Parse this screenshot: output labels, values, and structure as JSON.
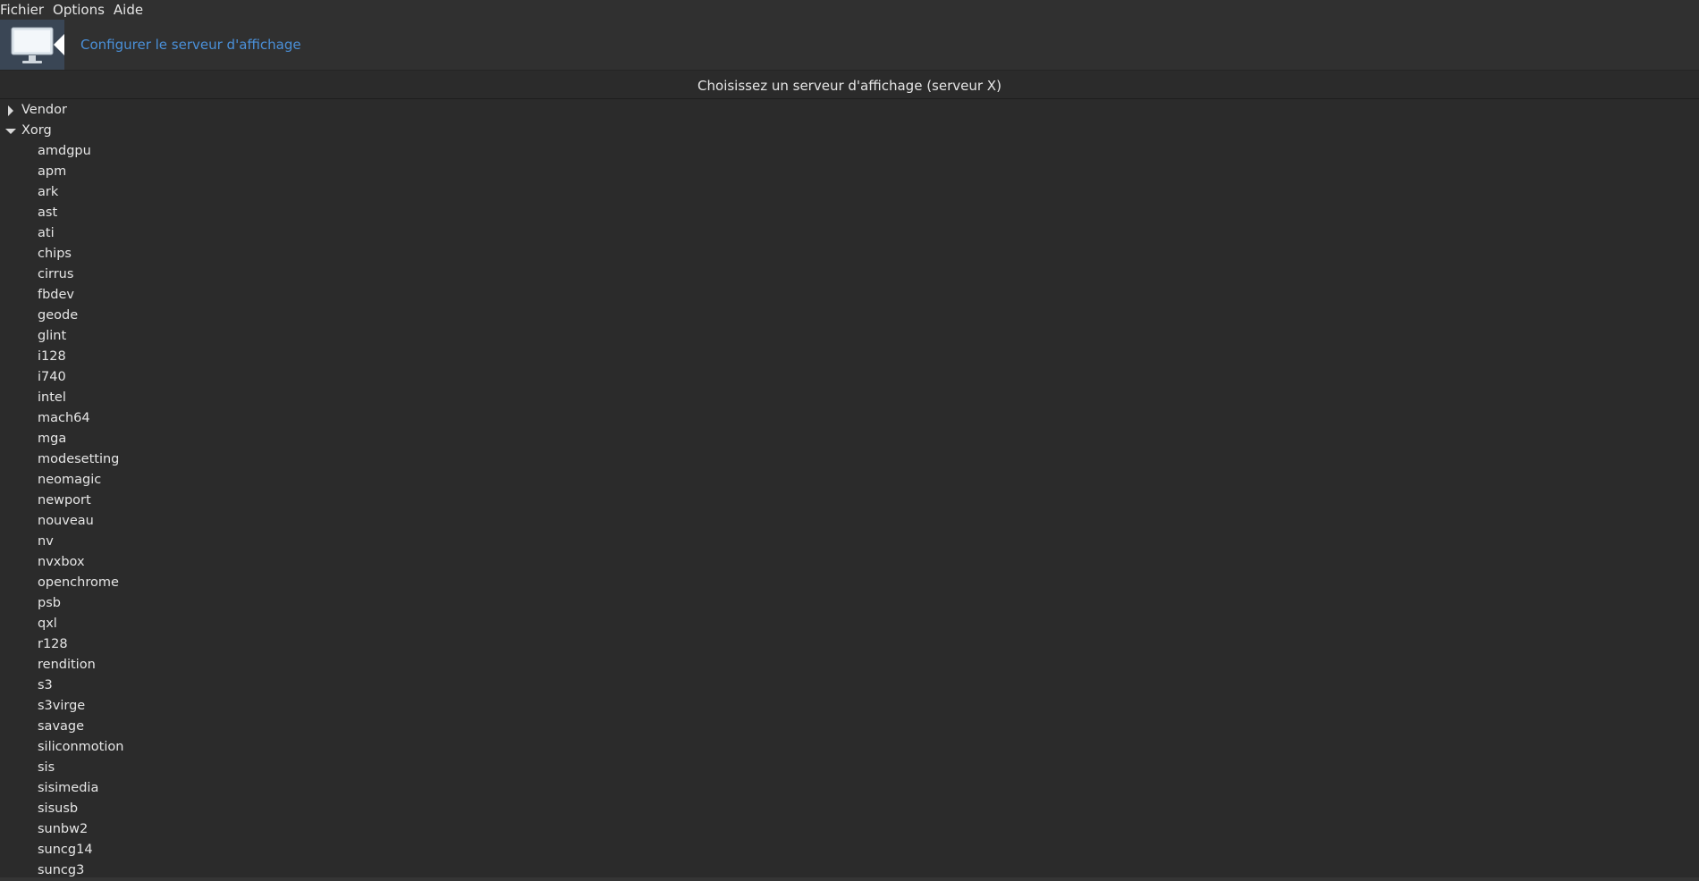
{
  "menubar": {
    "items": [
      "Fichier",
      "Options",
      "Aide"
    ]
  },
  "header": {
    "icon": "monitor-icon",
    "link_text": "Configurer le serveur d'affichage"
  },
  "subtitle": "Choisissez un serveur d'affichage (serveur X)",
  "tree": {
    "groups": [
      {
        "label": "Vendor",
        "expanded": false
      },
      {
        "label": "Xorg",
        "expanded": true
      }
    ],
    "xorg_children": [
      "amdgpu",
      "apm",
      "ark",
      "ast",
      "ati",
      "chips",
      "cirrus",
      "fbdev",
      "geode",
      "glint",
      "i128",
      "i740",
      "intel",
      "mach64",
      "mga",
      "modesetting",
      "neomagic",
      "newport",
      "nouveau",
      "nv",
      "nvxbox",
      "openchrome",
      "psb",
      "qxl",
      "r128",
      "rendition",
      "s3",
      "s3virge",
      "savage",
      "siliconmotion",
      "sis",
      "sisimedia",
      "sisusb",
      "sunbw2",
      "suncg14",
      "suncg3"
    ]
  },
  "colors": {
    "background": "#2b2b2b",
    "link": "#4a90d9"
  }
}
